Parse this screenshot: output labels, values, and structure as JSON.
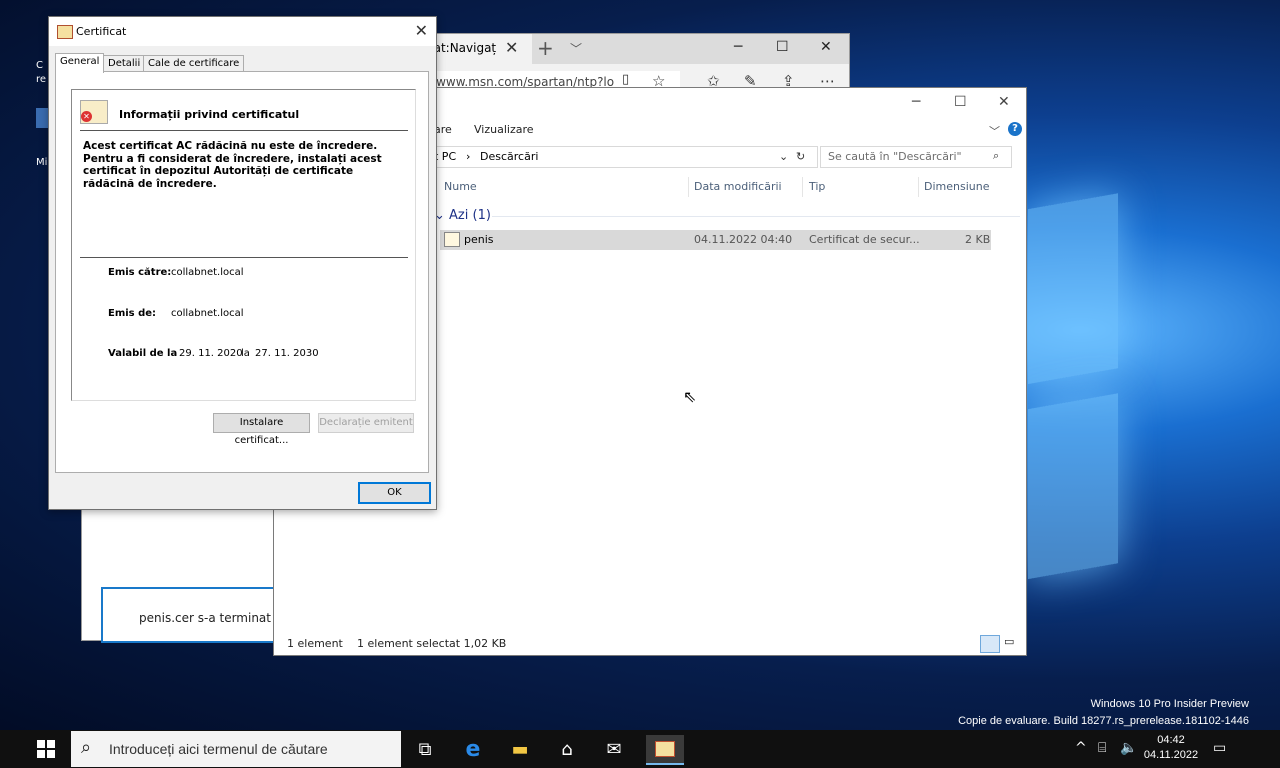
{
  "desktop": {
    "watermark_line1": "Windows 10 Pro Insider Preview",
    "watermark_line2": "Copie de evaluare. Build 18277.rs_prerelease.181102-1446"
  },
  "edge": {
    "tab_title": "cat:Navigaț",
    "address": "//www.msn.com/spartan/ntp?lo",
    "download_text": "penis.cer s-a terminat d"
  },
  "explorer": {
    "ribbon_tab1": "are",
    "ribbon_tab2": "Vizualizare",
    "crumb1": "t PC",
    "crumb2": "Descărcări",
    "search_placeholder": "Se caută în \"Descărcări\"",
    "columns": [
      "Nume",
      "Data modificării",
      "Tip",
      "Dimensiune"
    ],
    "group_label": "Azi (1)",
    "file": {
      "name": "penis",
      "date": "04.11.2022 04:40",
      "type": "Certificat de secur...",
      "size": "2 KB"
    },
    "status_count": "1 element",
    "status_selected": "1 element selectat  1,02 KB"
  },
  "cert": {
    "title": "Certificat",
    "tabs": [
      "General",
      "Detalii",
      "Cale de certificare"
    ],
    "info_title": "Informații privind certificatul",
    "warning": "Acest certificat AC rădăcină nu este de încredere. Pentru a fi considerat de încredere, instalați acest certificat în depozitul Autorități de certificate rădăcină de încredere.",
    "issued_to_label": "Emis către:",
    "issued_to": "collabnet.local",
    "issued_by_label": "Emis de:",
    "issued_by": "collabnet.local",
    "valid_label": "Valabil de la",
    "valid_from": "29. 11. 2020",
    "valid_sep": "la",
    "valid_to": "27. 11. 2030",
    "install_btn": "Instalare certificat...",
    "issuer_stmt_btn": "Declarație emitent",
    "ok_btn": "OK"
  },
  "taskbar": {
    "search_placeholder": "Introduceți aici termenul de căutare",
    "time": "04:42",
    "date": "04.11.2022"
  }
}
